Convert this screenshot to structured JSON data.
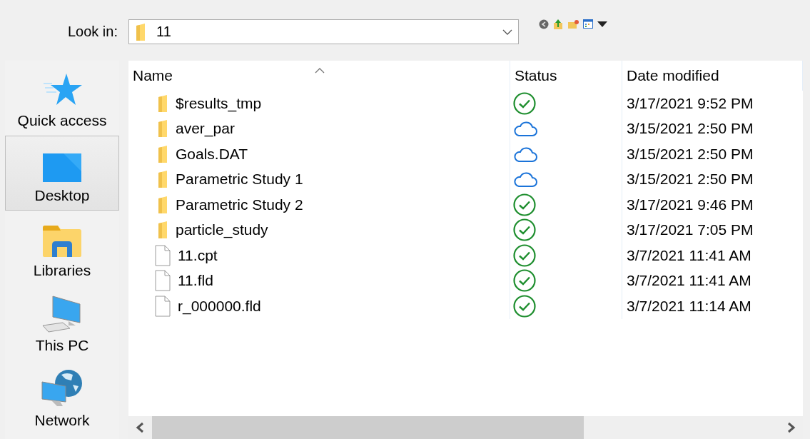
{
  "look_in": {
    "label": "Look in:",
    "value": "11"
  },
  "places": [
    {
      "label": "Quick access",
      "kind": "star",
      "selected": false
    },
    {
      "label": "Desktop",
      "kind": "desktop",
      "selected": true
    },
    {
      "label": "Libraries",
      "kind": "libraries",
      "selected": false
    },
    {
      "label": "This PC",
      "kind": "pc",
      "selected": false
    },
    {
      "label": "Network",
      "kind": "network",
      "selected": false
    }
  ],
  "columns": [
    "Name",
    "Status",
    "Date modified"
  ],
  "rows": [
    {
      "name": "$results_tmp",
      "kind": "folder",
      "synced": true,
      "date": "3/17/2021 9:52 PM"
    },
    {
      "name": "aver_par",
      "kind": "folder",
      "synced": false,
      "date": "3/15/2021 2:50 PM"
    },
    {
      "name": "Goals.DAT",
      "kind": "folder",
      "synced": false,
      "date": "3/15/2021 2:50 PM"
    },
    {
      "name": "Parametric Study 1",
      "kind": "folder",
      "synced": false,
      "date": "3/15/2021 2:50 PM"
    },
    {
      "name": "Parametric Study 2",
      "kind": "folder",
      "synced": true,
      "date": "3/17/2021 9:46 PM"
    },
    {
      "name": "particle_study",
      "kind": "folder",
      "synced": true,
      "date": "3/17/2021 7:05 PM"
    },
    {
      "name": "11.cpt",
      "kind": "file",
      "synced": true,
      "date": "3/7/2021 11:41 AM"
    },
    {
      "name": "11.fld",
      "kind": "file",
      "synced": true,
      "date": "3/7/2021 11:41 AM"
    },
    {
      "name": "r_000000.fld",
      "kind": "file",
      "synced": true,
      "date": "3/7/2021 11:14 AM"
    }
  ]
}
